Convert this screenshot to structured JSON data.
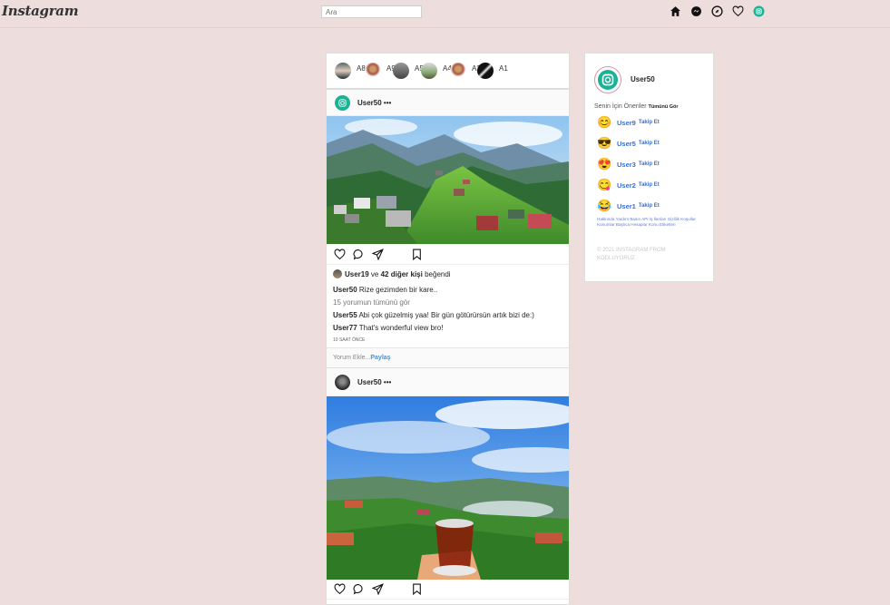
{
  "header": {
    "logo": "Instagram",
    "search_placeholder": "Ara",
    "icons": [
      "home-icon",
      "messenger-icon",
      "explore-icon",
      "heart-icon",
      "profile-icon"
    ]
  },
  "stories": [
    {
      "label": "A8"
    },
    {
      "label": "A9"
    },
    {
      "label": "A5"
    },
    {
      "label": "A4"
    },
    {
      "label": "A2"
    },
    {
      "label": "A1"
    }
  ],
  "post1": {
    "user": "User50 •••",
    "likes_user": "User19",
    "likes_and": "ve",
    "likes_others": "42 diğer kişi",
    "likes_suffix": "beğendi",
    "caption_user": "User50",
    "caption_text": "Rize gezimden bir kare..",
    "view_all": "15 yorumun tümünü gör",
    "comments": [
      {
        "user": "User55",
        "text": "Abi çok güzelmiş yaa! Bir gün götürürsün artık bizi de:)"
      },
      {
        "user": "User77",
        "text": "That's wonderful view bro!"
      }
    ],
    "time": "10 SAAT ÖNCE",
    "comment_placeholder": "Yorum Ekle...",
    "share": "Paylaş"
  },
  "post2": {
    "user": "User50 •••"
  },
  "sidebar": {
    "username": "User50",
    "suggestions_title": "Senin İçin Öneriler",
    "see_all": "Tümünü Gör",
    "follow_label": "Takip Et",
    "suggestions": [
      {
        "emoji": "😊",
        "name": "User9"
      },
      {
        "emoji": "😎",
        "name": "User5"
      },
      {
        "emoji": "😍",
        "name": "User3"
      },
      {
        "emoji": "😋",
        "name": "User2"
      },
      {
        "emoji": "😂",
        "name": "User1"
      }
    ],
    "links": "Hakkında Yardım Basın API İş İlanları Gizlilik Koşullar Konumlar Başlıca Hesaplar Konu Etiketleri",
    "copyright": "© 2021 INSTAGRAM FROM KODLUYORUZ"
  },
  "colors": {
    "background": "#eddddd",
    "link_blue": "#3a6fd1",
    "share_blue": "#3897f0",
    "brand_teal": "#19b394"
  }
}
